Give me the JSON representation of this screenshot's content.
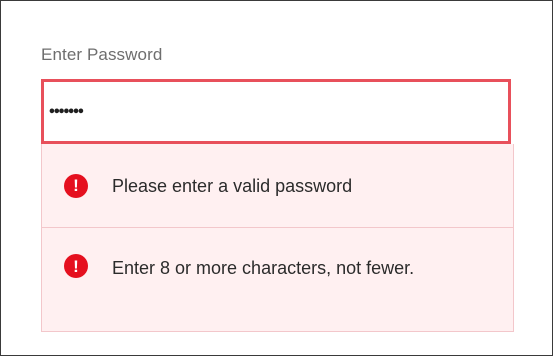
{
  "field": {
    "label": "Enter Password",
    "masked_value": "•••••••"
  },
  "errors": [
    {
      "icon": "exclamation-circle-icon",
      "text": "Please enter a valid password"
    },
    {
      "icon": "exclamation-circle-icon",
      "text": "Enter 8 or more characters, not fewer."
    }
  ],
  "colors": {
    "error_border": "#e8505b",
    "error_icon": "#e5101f",
    "error_background": "#fff0f1"
  }
}
